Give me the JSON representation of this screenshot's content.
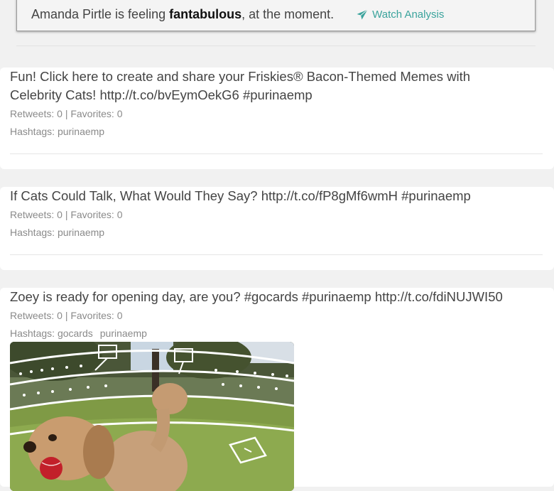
{
  "mood": {
    "prefix": "Amanda Pirtle is feeling ",
    "mood_word": "fantabulous",
    "suffix": ", at the moment.",
    "watch_label": "Watch Analysis",
    "accent_color": "#3aa39c",
    "watch_icon": "paper-plane-icon"
  },
  "tweets": [
    {
      "text": "Fun! Click here to create and share your Friskies® Bacon-Themed Memes with Celebrity Cats! http://t.co/bvEymOekG6 #purinaemp",
      "stats": "Retweets: 0 | Favorites: 0",
      "hashtags_label": "Hashtags:",
      "hashtags": [
        "purinaemp"
      ]
    },
    {
      "text": "If Cats Could Talk, What Would They Say? http://t.co/fP8gMf6wmH #purinaemp",
      "stats": "Retweets: 0 | Favorites: 0",
      "hashtags_label": "Hashtags:",
      "hashtags": [
        "purinaemp"
      ]
    },
    {
      "text": "Zoey is ready for opening day, are you? #gocards #purinaemp http://t.co/fdiNUJWI50",
      "stats": "Retweets: 0 | Favorites: 0",
      "hashtags_label": "Hashtags:",
      "hashtags": [
        "gocards",
        "purinaemp"
      ],
      "image": "dog-in-stadium-photo"
    }
  ]
}
